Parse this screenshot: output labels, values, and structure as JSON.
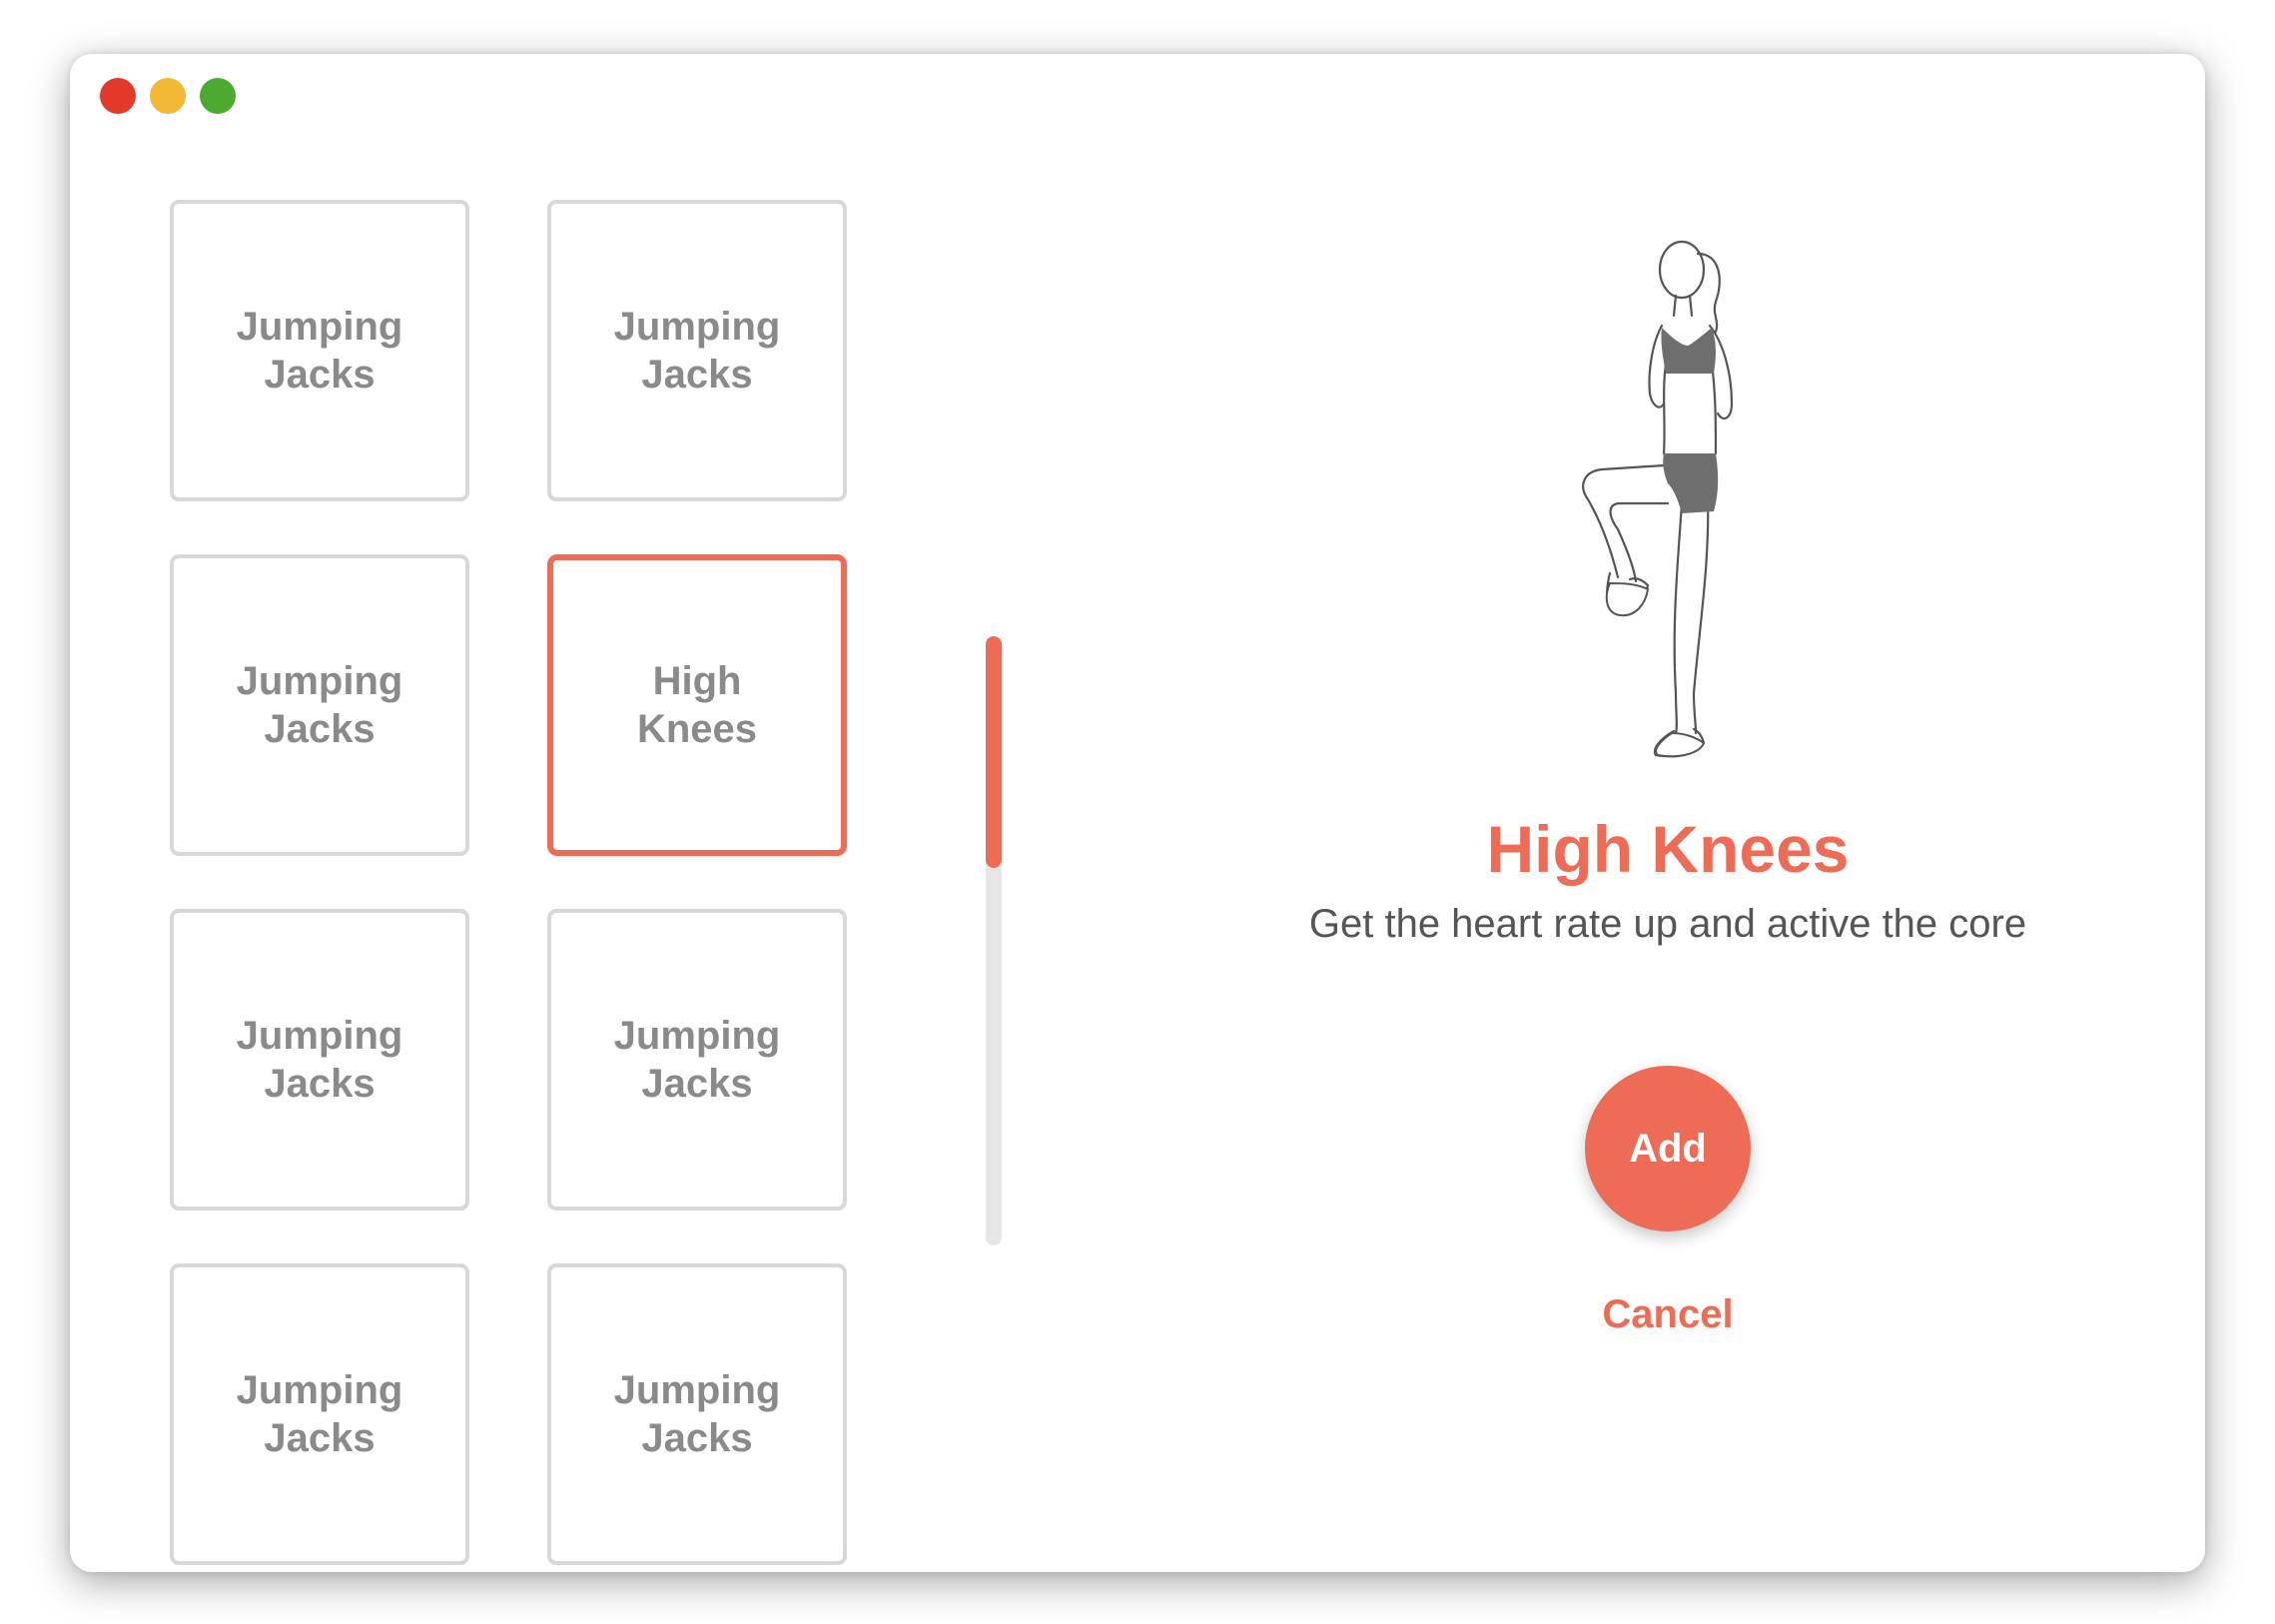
{
  "window": {
    "controls": [
      "close",
      "minimize",
      "zoom"
    ]
  },
  "exercises": {
    "tiles": [
      {
        "label": "Jumping Jacks",
        "selected": false
      },
      {
        "label": "Jumping Jacks",
        "selected": false
      },
      {
        "label": "Jumping Jacks",
        "selected": false
      },
      {
        "label": "High Knees",
        "selected": true
      },
      {
        "label": "Jumping Jacks",
        "selected": false
      },
      {
        "label": "Jumping Jacks",
        "selected": false
      },
      {
        "label": "Jumping Jacks",
        "selected": false
      },
      {
        "label": "Jumping Jacks",
        "selected": false
      }
    ]
  },
  "scrollbar": {
    "position_fraction": 0.0,
    "thumb_fraction": 0.38
  },
  "detail": {
    "illustration": "woman-high-knees-figure",
    "title": "High Knees",
    "description": "Get the heart rate up and active the core",
    "add_label": "Add",
    "cancel_label": "Cancel"
  },
  "colors": {
    "accent": "#ee6b55",
    "tile_border": "#d8d8d8",
    "tile_text": "#8a8a8a",
    "body_text": "#555555",
    "close": "#e2392b",
    "minimize": "#f2b836",
    "zoom": "#4cab2e"
  }
}
